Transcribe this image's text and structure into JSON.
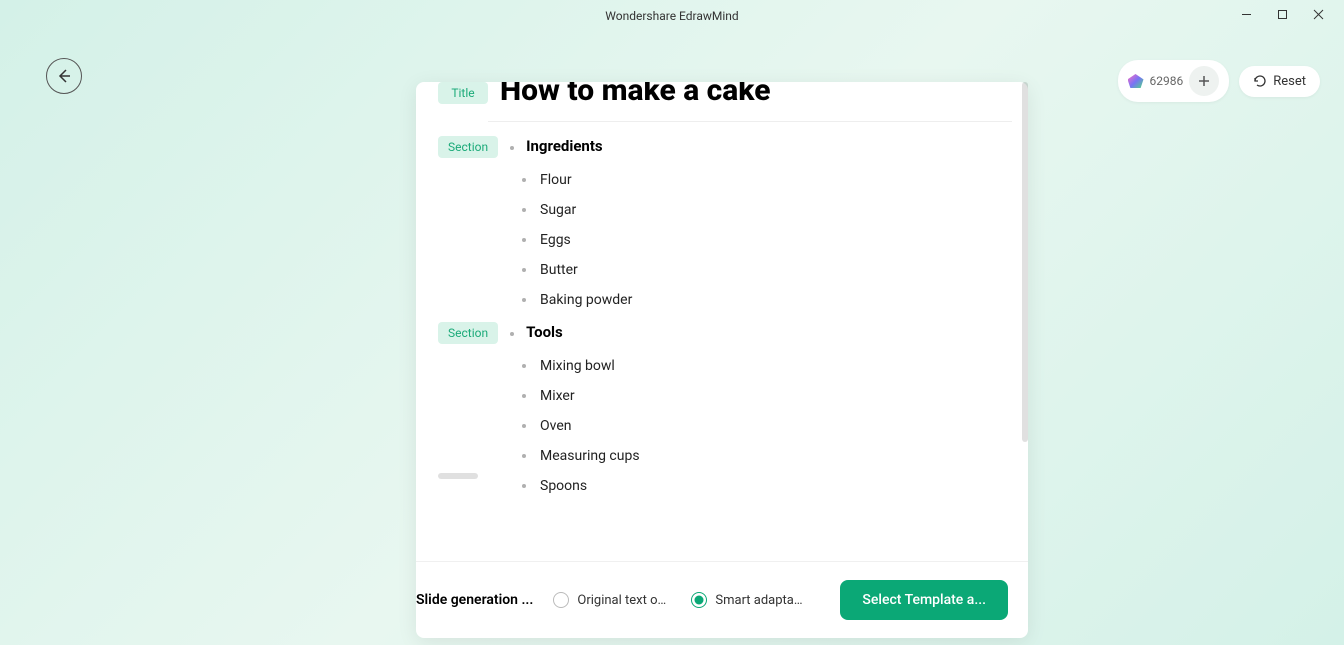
{
  "app": {
    "title": "Wondershare EdrawMind"
  },
  "topbar": {
    "credits": "62986",
    "reset": "Reset"
  },
  "document": {
    "titleTag": "Title",
    "title": "How to make a cake",
    "sections": [
      {
        "tag": "Section",
        "heading": "Ingredients",
        "items": [
          "Flour",
          "Sugar",
          "Eggs",
          "Butter",
          "Baking powder"
        ]
      },
      {
        "tag": "Section",
        "heading": "Tools",
        "items": [
          "Mixing bowl",
          "Mixer",
          "Oven",
          "Measuring cups",
          "Spoons"
        ]
      }
    ]
  },
  "bottom": {
    "label": "Slide generation ...",
    "option1": "Original text o...",
    "option2": "Smart adaptation",
    "cta": "Select Template a..."
  }
}
